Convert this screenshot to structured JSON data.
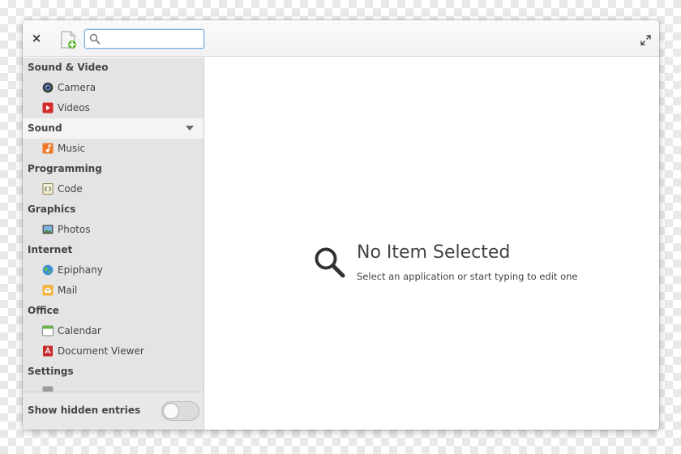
{
  "titlebar": {
    "close_label": "×",
    "search": {
      "value": "",
      "placeholder": ""
    }
  },
  "sidebar": {
    "categories": [
      {
        "name": "Sound & Video",
        "items": [
          {
            "label": "Camera",
            "icon": "camera-icon"
          },
          {
            "label": "Videos",
            "icon": "videos-icon"
          }
        ]
      },
      {
        "name": "Sound",
        "expanded": true,
        "items": [
          {
            "label": "Music",
            "icon": "music-icon"
          }
        ]
      },
      {
        "name": "Programming",
        "items": [
          {
            "label": "Code",
            "icon": "code-icon"
          }
        ]
      },
      {
        "name": "Graphics",
        "items": [
          {
            "label": "Photos",
            "icon": "photos-icon"
          }
        ]
      },
      {
        "name": "Internet",
        "items": [
          {
            "label": "Epiphany",
            "icon": "epiphany-icon"
          },
          {
            "label": "Mail",
            "icon": "mail-icon"
          }
        ]
      },
      {
        "name": "Office",
        "items": [
          {
            "label": "Calendar",
            "icon": "calendar-icon"
          },
          {
            "label": "Document Viewer",
            "icon": "document-viewer-icon"
          }
        ]
      },
      {
        "name": "Settings",
        "items": [
          {
            "label": "",
            "icon": "settings-app-icon"
          }
        ]
      }
    ],
    "footer": {
      "label": "Show hidden entries",
      "toggle_on": false
    }
  },
  "content": {
    "title": "No Item Selected",
    "subtitle": "Select an application or start typing to edit one"
  },
  "colors": {
    "sidebar_bg": "#e4e4e4",
    "accent_focus": "#7aaedb"
  }
}
